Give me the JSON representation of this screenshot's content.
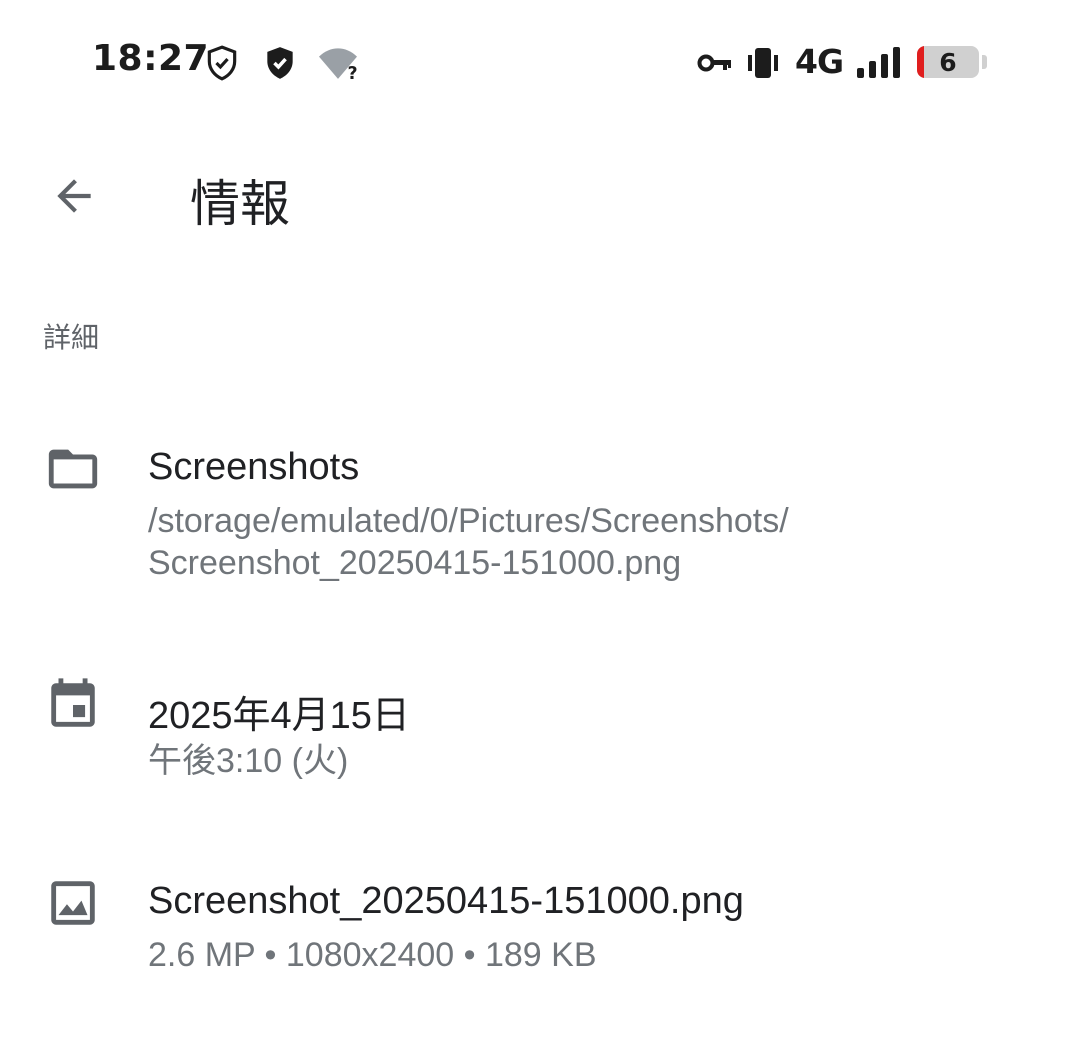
{
  "status_bar": {
    "time": "18:27",
    "network": "4G",
    "battery_level": "6",
    "icons": [
      "shield-outline-icon",
      "shield-filled-icon",
      "wifi-unknown-icon",
      "vpn-key-icon",
      "vibrate-icon",
      "signal-icon",
      "battery-icon"
    ]
  },
  "app_bar": {
    "back_icon": "arrow-back-icon",
    "title": "情報"
  },
  "section": {
    "header": "詳細"
  },
  "details": {
    "folder": {
      "icon": "folder-icon",
      "title": "Screenshots",
      "path_line1": "/storage/emulated/0/Pictures/Screenshots/",
      "path_line2": "Screenshot_20250415-151000.png"
    },
    "date": {
      "icon": "calendar-icon",
      "title": "2025年4月15日",
      "subtitle": "午後3:10 (火)"
    },
    "image": {
      "icon": "image-icon",
      "title": "Screenshot_20250415-151000.png",
      "subtitle": "2.6 MP • 1080x2400 • 189 KB"
    }
  },
  "colors": {
    "text_primary": "#202124",
    "text_secondary": "#70757a",
    "icon": "#5f6368",
    "battery_low": "#e01e1e"
  }
}
